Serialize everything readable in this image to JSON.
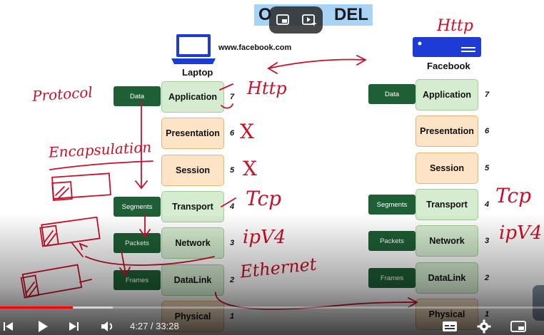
{
  "slide": {
    "title_visible": "DEL",
    "title_left_char": "O",
    "left_host": {
      "url": "www.facebook.com",
      "label": "Laptop"
    },
    "right_host": {
      "label": "Facebook"
    },
    "layers_left": [
      {
        "name": "Application",
        "num": "7",
        "style": "green"
      },
      {
        "name": "Presentation",
        "num": "6",
        "style": "orange"
      },
      {
        "name": "Session",
        "num": "5",
        "style": "orange"
      },
      {
        "name": "Transport",
        "num": "4",
        "style": "green"
      },
      {
        "name": "Network",
        "num": "3",
        "style": "green"
      },
      {
        "name": "DataLink",
        "num": "2",
        "style": "green"
      },
      {
        "name": "Physical",
        "num": "1",
        "style": "orange"
      }
    ],
    "layers_right": [
      {
        "name": "Application",
        "num": "7",
        "style": "green"
      },
      {
        "name": "Presentation",
        "num": "6",
        "style": "orange"
      },
      {
        "name": "Session",
        "num": "5",
        "style": "orange"
      },
      {
        "name": "Transport",
        "num": "4",
        "style": "green"
      },
      {
        "name": "Network",
        "num": "3",
        "style": "green"
      },
      {
        "name": "DataLink",
        "num": "2",
        "style": "green"
      },
      {
        "name": "Physical",
        "num": "1",
        "style": "orange"
      }
    ],
    "pdu_left": [
      "Data",
      "Segments",
      "Packets",
      "Frames"
    ],
    "pdu_right": [
      "Data",
      "Segments",
      "Packets",
      "Frames"
    ],
    "handwriting": {
      "protocol": "Protocol",
      "encapsulation": "Encapsulation",
      "http_top": "Http",
      "http_mid": "Http",
      "tcp_left": "Tcp",
      "tcp_right": "Tcp",
      "ipv4_left": "ipV4",
      "ipv4_right": "ipV4",
      "ethernet": "Ethernet",
      "x6": "X",
      "x5": "X"
    }
  },
  "player": {
    "time_current": "4:27",
    "time_total": "33:28",
    "progress_fraction": 0.134,
    "buffer_fraction": 0.208,
    "accent": "#ff0000"
  }
}
